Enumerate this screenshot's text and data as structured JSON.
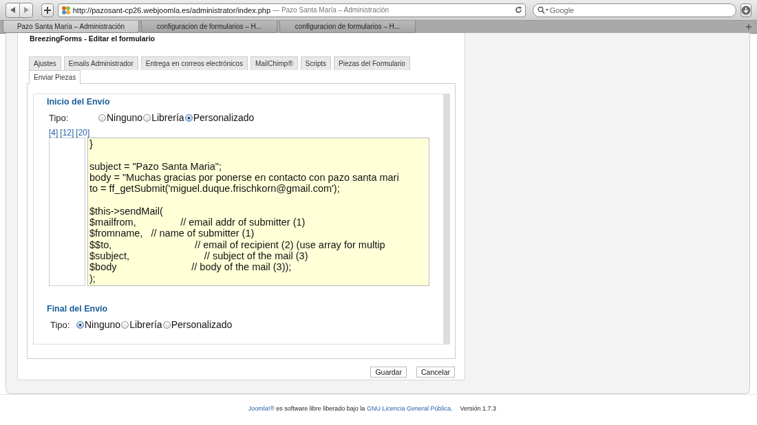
{
  "browser": {
    "url": "http://pazosant-cp26.webjoomla.es/administrator/index.php",
    "page_title": "— Pazo Santa María – Administración",
    "search": {
      "placeholder": "Google"
    },
    "tabs": [
      {
        "label": "Pazo Santa María – Administración",
        "selected": true
      },
      {
        "label": "configuracion de formularios – H...",
        "selected": false
      },
      {
        "label": "configuracion de formularios – H...",
        "selected": false
      }
    ]
  },
  "heading": "BreezingForms - Editar el formulario",
  "form_tabs": [
    {
      "label": "Ajustes",
      "selected": false
    },
    {
      "label": "Emails Administrador",
      "selected": false
    },
    {
      "label": "Entrega en correos electrónicos",
      "selected": false
    },
    {
      "label": "MailChimp®",
      "selected": false
    },
    {
      "label": "Scripts",
      "selected": false
    },
    {
      "label": "Piezas del Formulario",
      "selected": false
    },
    {
      "label": "Enviar Piezas",
      "selected": true
    }
  ],
  "sections": [
    {
      "title": "Inicio del Envío",
      "type_label": "Tipo:",
      "options": [
        {
          "label": "Ninguno",
          "selected": false
        },
        {
          "label": "Librería",
          "selected": false
        },
        {
          "label": "Personalizado",
          "selected": true
        }
      ],
      "size_links": [
        "[4]",
        "[12]",
        "[20]"
      ],
      "code": "}\n\nsubject = \"Pazo Santa Maria\";\nbody = \"Muchas gracias por ponerse en contacto con pazo santa mari\nto = ff_getSubmit('miguel.duque.frischkorn@gmail.com');\n\n$this->sendMail(\n$mailfrom,                // email addr of submitter (1)\n$fromname,   // name of submitter (1)\n$$to,                              // email of recipient (2) (use array for multip\n$subject,                           // subject of the mail (3)\n$body                           // body of the mail (3));\n);"
    },
    {
      "title": "Final del Envío",
      "type_label": "Tipo:",
      "options": [
        {
          "label": "Ninguno",
          "selected": true
        },
        {
          "label": "Librería",
          "selected": false
        },
        {
          "label": "Personalizado",
          "selected": false
        }
      ]
    }
  ],
  "buttons": [
    "Guardar",
    "Cancelar"
  ],
  "footer": {
    "link_1": "Joomla!®",
    "text": " es software libre liberado bajo la ",
    "link_2": "GNU Licencia General Pública",
    "end": ".",
    "version": "Versión 1.7.3"
  }
}
